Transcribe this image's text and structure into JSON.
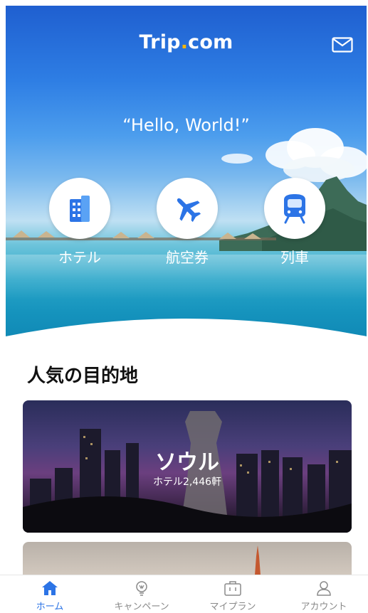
{
  "header": {
    "logo_main": "Trip",
    "logo_dot": ".",
    "logo_suffix": "com"
  },
  "hero": {
    "greeting": "“Hello, World!”"
  },
  "services": [
    {
      "label": "ホテル",
      "icon": "hotel-icon"
    },
    {
      "label": "航空券",
      "icon": "airplane-icon"
    },
    {
      "label": "列車",
      "icon": "train-icon"
    }
  ],
  "section": {
    "title": "人気の目的地"
  },
  "destinations": [
    {
      "name": "ソウル",
      "subtitle": "ホテル2,446軒"
    }
  ],
  "tabbar": {
    "items": [
      {
        "label": "ホーム",
        "icon": "home-icon",
        "active": true
      },
      {
        "label": "キャンペーン",
        "icon": "lightbulb-icon",
        "active": false
      },
      {
        "label": "マイプラン",
        "icon": "briefcase-icon",
        "active": false
      },
      {
        "label": "アカウント",
        "icon": "user-icon",
        "active": false
      }
    ]
  },
  "colors": {
    "accent": "#2c74e6",
    "logo_dot": "#f7b500"
  }
}
